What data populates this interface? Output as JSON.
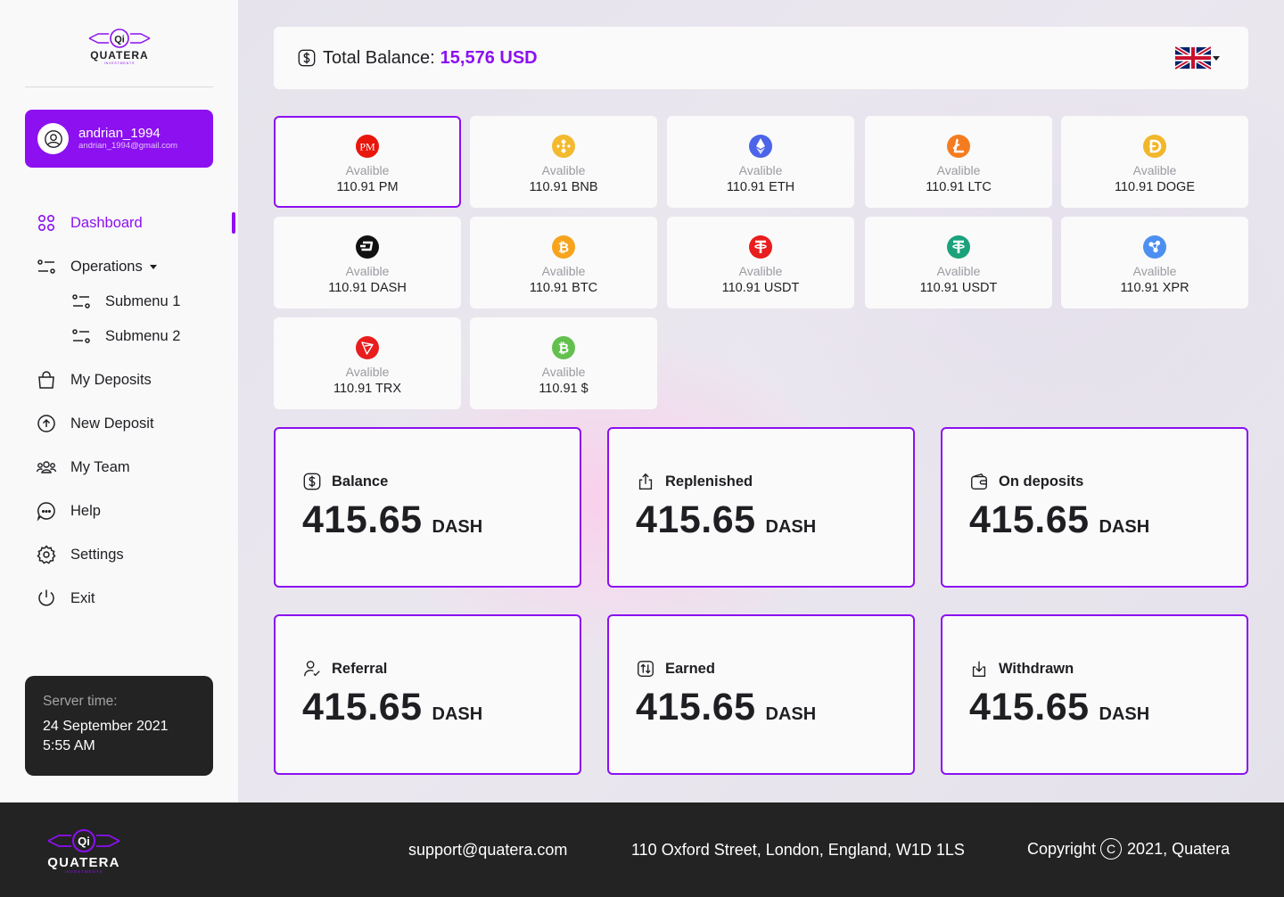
{
  "brand": {
    "logo_mark": "Qi",
    "logo_name": "QUATERA",
    "logo_sub": "INVESTMENTS"
  },
  "user": {
    "name": "andrian_1994",
    "email": "andrian_1994@gmail.com"
  },
  "nav": {
    "dashboard": "Dashboard",
    "operations": "Operations",
    "submenu1": "Submenu 1",
    "submenu2": "Submenu 2",
    "my_deposits": "My Deposits",
    "new_deposit": "New Deposit",
    "my_team": "My Team",
    "help": "Help",
    "settings": "Settings",
    "exit": "Exit"
  },
  "server": {
    "label": "Server time:",
    "date": "24 September 2021",
    "time": "5:55 AM"
  },
  "balance": {
    "label": "Total Balance:",
    "value": "15,576 USD"
  },
  "coins": [
    {
      "avail": "Avalible",
      "amount": "110.91 PM",
      "icon": "pm-icon",
      "color": "#e8160c"
    },
    {
      "avail": "Avalible",
      "amount": "110.91 BNB",
      "icon": "bnb-icon",
      "color": "#f3ba2f"
    },
    {
      "avail": "Avalible",
      "amount": "110.91 ETH",
      "icon": "eth-icon",
      "color": "#4b64e8"
    },
    {
      "avail": "Avalible",
      "amount": "110.91 LTC",
      "icon": "ltc-icon",
      "color": "#f47c20"
    },
    {
      "avail": "Avalible",
      "amount": "110.91 DOGE",
      "icon": "doge-icon",
      "color": "#f2b62b"
    },
    {
      "avail": "Avalible",
      "amount": "110.91 DASH",
      "icon": "dash-icon",
      "color": "#111111"
    },
    {
      "avail": "Avalible",
      "amount": "110.91 BTC",
      "icon": "btc-icon",
      "color": "#f7a31c"
    },
    {
      "avail": "Avalible",
      "amount": "110.91 USDT",
      "icon": "usdt-red-icon",
      "color": "#e81d1d"
    },
    {
      "avail": "Avalible",
      "amount": "110.91 USDT",
      "icon": "usdt-icon",
      "color": "#1ba27a"
    },
    {
      "avail": "Avalible",
      "amount": "110.91 XPR",
      "icon": "xrp-icon",
      "color": "#4d8ff0"
    },
    {
      "avail": "Avalible",
      "amount": "110.91 TRX",
      "icon": "trx-icon",
      "color": "#e81d1d"
    },
    {
      "avail": "Avalible",
      "amount": "110.91 $",
      "icon": "bch-icon",
      "color": "#63c04f"
    }
  ],
  "stats": [
    {
      "title": "Balance",
      "value": "415.65",
      "unit": "DASH",
      "icon": "dollar-icon"
    },
    {
      "title": "Replenished",
      "value": "415.65",
      "unit": "DASH",
      "icon": "upload-icon"
    },
    {
      "title": "On deposits",
      "value": "415.65",
      "unit": "DASH",
      "icon": "wallet-icon"
    },
    {
      "title": "Referral",
      "value": "415.65",
      "unit": "DASH",
      "icon": "user-check-icon"
    },
    {
      "title": "Earned",
      "value": "415.65",
      "unit": "DASH",
      "icon": "exchange-icon"
    },
    {
      "title": "Withdrawn",
      "value": "415.65",
      "unit": "DASH",
      "icon": "download-icon"
    }
  ],
  "footer": {
    "email": "support@quatera.com",
    "address": "110 Oxford Street, London, England, W1D 1LS",
    "copyright_prefix": "Copyright",
    "copyright_symbol": "C",
    "copyright_suffix": "2021, Quatera"
  },
  "colors": {
    "accent": "#8c10f0",
    "dark": "#232323"
  }
}
